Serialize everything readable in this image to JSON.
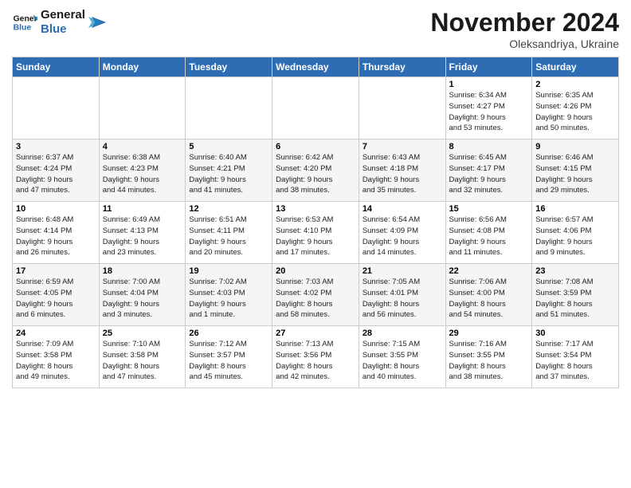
{
  "header": {
    "logo_line1": "General",
    "logo_line2": "Blue",
    "month": "November 2024",
    "location": "Oleksandriya, Ukraine"
  },
  "days_of_week": [
    "Sunday",
    "Monday",
    "Tuesday",
    "Wednesday",
    "Thursday",
    "Friday",
    "Saturday"
  ],
  "weeks": [
    [
      {
        "day": "",
        "detail": ""
      },
      {
        "day": "",
        "detail": ""
      },
      {
        "day": "",
        "detail": ""
      },
      {
        "day": "",
        "detail": ""
      },
      {
        "day": "",
        "detail": ""
      },
      {
        "day": "1",
        "detail": "Sunrise: 6:34 AM\nSunset: 4:27 PM\nDaylight: 9 hours\nand 53 minutes."
      },
      {
        "day": "2",
        "detail": "Sunrise: 6:35 AM\nSunset: 4:26 PM\nDaylight: 9 hours\nand 50 minutes."
      }
    ],
    [
      {
        "day": "3",
        "detail": "Sunrise: 6:37 AM\nSunset: 4:24 PM\nDaylight: 9 hours\nand 47 minutes."
      },
      {
        "day": "4",
        "detail": "Sunrise: 6:38 AM\nSunset: 4:23 PM\nDaylight: 9 hours\nand 44 minutes."
      },
      {
        "day": "5",
        "detail": "Sunrise: 6:40 AM\nSunset: 4:21 PM\nDaylight: 9 hours\nand 41 minutes."
      },
      {
        "day": "6",
        "detail": "Sunrise: 6:42 AM\nSunset: 4:20 PM\nDaylight: 9 hours\nand 38 minutes."
      },
      {
        "day": "7",
        "detail": "Sunrise: 6:43 AM\nSunset: 4:18 PM\nDaylight: 9 hours\nand 35 minutes."
      },
      {
        "day": "8",
        "detail": "Sunrise: 6:45 AM\nSunset: 4:17 PM\nDaylight: 9 hours\nand 32 minutes."
      },
      {
        "day": "9",
        "detail": "Sunrise: 6:46 AM\nSunset: 4:15 PM\nDaylight: 9 hours\nand 29 minutes."
      }
    ],
    [
      {
        "day": "10",
        "detail": "Sunrise: 6:48 AM\nSunset: 4:14 PM\nDaylight: 9 hours\nand 26 minutes."
      },
      {
        "day": "11",
        "detail": "Sunrise: 6:49 AM\nSunset: 4:13 PM\nDaylight: 9 hours\nand 23 minutes."
      },
      {
        "day": "12",
        "detail": "Sunrise: 6:51 AM\nSunset: 4:11 PM\nDaylight: 9 hours\nand 20 minutes."
      },
      {
        "day": "13",
        "detail": "Sunrise: 6:53 AM\nSunset: 4:10 PM\nDaylight: 9 hours\nand 17 minutes."
      },
      {
        "day": "14",
        "detail": "Sunrise: 6:54 AM\nSunset: 4:09 PM\nDaylight: 9 hours\nand 14 minutes."
      },
      {
        "day": "15",
        "detail": "Sunrise: 6:56 AM\nSunset: 4:08 PM\nDaylight: 9 hours\nand 11 minutes."
      },
      {
        "day": "16",
        "detail": "Sunrise: 6:57 AM\nSunset: 4:06 PM\nDaylight: 9 hours\nand 9 minutes."
      }
    ],
    [
      {
        "day": "17",
        "detail": "Sunrise: 6:59 AM\nSunset: 4:05 PM\nDaylight: 9 hours\nand 6 minutes."
      },
      {
        "day": "18",
        "detail": "Sunrise: 7:00 AM\nSunset: 4:04 PM\nDaylight: 9 hours\nand 3 minutes."
      },
      {
        "day": "19",
        "detail": "Sunrise: 7:02 AM\nSunset: 4:03 PM\nDaylight: 9 hours\nand 1 minute."
      },
      {
        "day": "20",
        "detail": "Sunrise: 7:03 AM\nSunset: 4:02 PM\nDaylight: 8 hours\nand 58 minutes."
      },
      {
        "day": "21",
        "detail": "Sunrise: 7:05 AM\nSunset: 4:01 PM\nDaylight: 8 hours\nand 56 minutes."
      },
      {
        "day": "22",
        "detail": "Sunrise: 7:06 AM\nSunset: 4:00 PM\nDaylight: 8 hours\nand 54 minutes."
      },
      {
        "day": "23",
        "detail": "Sunrise: 7:08 AM\nSunset: 3:59 PM\nDaylight: 8 hours\nand 51 minutes."
      }
    ],
    [
      {
        "day": "24",
        "detail": "Sunrise: 7:09 AM\nSunset: 3:58 PM\nDaylight: 8 hours\nand 49 minutes."
      },
      {
        "day": "25",
        "detail": "Sunrise: 7:10 AM\nSunset: 3:58 PM\nDaylight: 8 hours\nand 47 minutes."
      },
      {
        "day": "26",
        "detail": "Sunrise: 7:12 AM\nSunset: 3:57 PM\nDaylight: 8 hours\nand 45 minutes."
      },
      {
        "day": "27",
        "detail": "Sunrise: 7:13 AM\nSunset: 3:56 PM\nDaylight: 8 hours\nand 42 minutes."
      },
      {
        "day": "28",
        "detail": "Sunrise: 7:15 AM\nSunset: 3:55 PM\nDaylight: 8 hours\nand 40 minutes."
      },
      {
        "day": "29",
        "detail": "Sunrise: 7:16 AM\nSunset: 3:55 PM\nDaylight: 8 hours\nand 38 minutes."
      },
      {
        "day": "30",
        "detail": "Sunrise: 7:17 AM\nSunset: 3:54 PM\nDaylight: 8 hours\nand 37 minutes."
      }
    ]
  ]
}
